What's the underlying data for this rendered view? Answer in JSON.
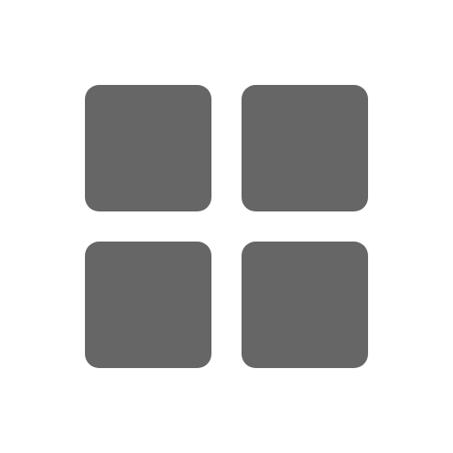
{
  "icon": {
    "name": "grid-icon",
    "fill_color": "#666666",
    "background_color": "#ffffff",
    "tiles": [
      {
        "name": "grid-tile-top-left"
      },
      {
        "name": "grid-tile-top-right"
      },
      {
        "name": "grid-tile-bottom-left"
      },
      {
        "name": "grid-tile-bottom-right"
      }
    ]
  }
}
